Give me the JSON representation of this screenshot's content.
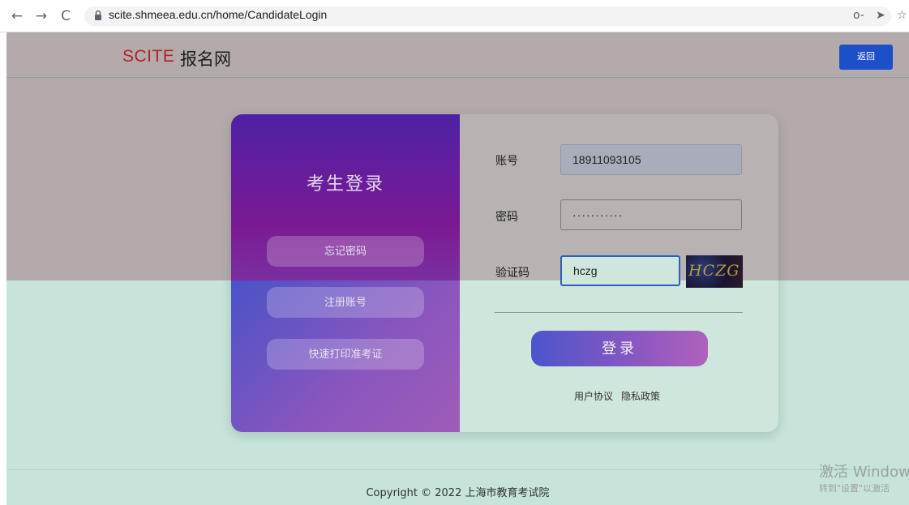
{
  "browser": {
    "url": "scite.shmeea.edu.cn/home/CandidateLogin",
    "back_glyph": "←",
    "forward_glyph": "→",
    "reload_glyph": "C",
    "key_glyph": "o-",
    "send_glyph": "➤",
    "star_glyph": "☆"
  },
  "header": {
    "logo_brand": "SCITE",
    "logo_site": "报名网",
    "back_label": "返回",
    "brand_color": "#b51f26",
    "button_color": "#1d4fc9"
  },
  "login_panel": {
    "title": "考生登录",
    "side_buttons": {
      "forgot": "忘记密码",
      "register": "注册账号",
      "print": "快速打印准考证"
    }
  },
  "form": {
    "account_label": "账号",
    "account_value": "18911093105",
    "password_label": "密码",
    "password_value": "···········",
    "captcha_label": "验证码",
    "captcha_value": "hczg",
    "captcha_image_text": "HCZG",
    "submit_label": "登录",
    "user_agreement": "用户协议",
    "privacy_policy": "隐私政策"
  },
  "footer": {
    "copyright": "Copyright © 2022 上海市教育考试院"
  },
  "os_watermark": {
    "line1": "激活 Windows",
    "line2": "转到\"设置\"以激活"
  }
}
